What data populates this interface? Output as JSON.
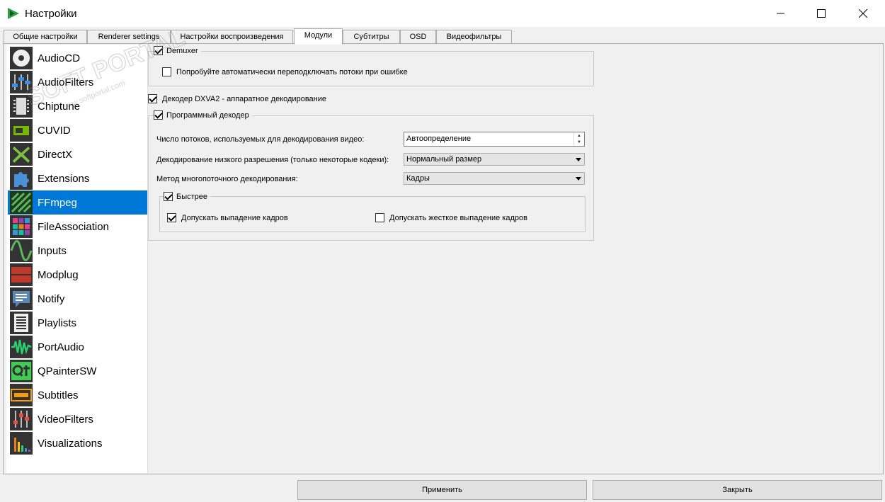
{
  "window": {
    "title": "Настройки",
    "accent": "#0078d7"
  },
  "tabs": [
    {
      "label": "Общие настройки",
      "active": false
    },
    {
      "label": "Renderer settings",
      "active": false
    },
    {
      "label": "Настройки воспроизведения",
      "active": false
    },
    {
      "label": "Модули",
      "active": true
    },
    {
      "label": "Субтитры",
      "active": false
    },
    {
      "label": "OSD",
      "active": false
    },
    {
      "label": "Видеофильтры",
      "active": false
    }
  ],
  "sidebar": {
    "selected": "FFmpeg",
    "items": [
      {
        "label": "AudioCD",
        "icon": "audiocd-icon"
      },
      {
        "label": "AudioFilters",
        "icon": "audiofilters-icon"
      },
      {
        "label": "Chiptune",
        "icon": "chiptune-icon"
      },
      {
        "label": "CUVID",
        "icon": "cuvid-icon"
      },
      {
        "label": "DirectX",
        "icon": "directx-icon"
      },
      {
        "label": "Extensions",
        "icon": "extensions-icon"
      },
      {
        "label": "FFmpeg",
        "icon": "ffmpeg-icon"
      },
      {
        "label": "FileAssociation",
        "icon": "fileassociation-icon"
      },
      {
        "label": "Inputs",
        "icon": "inputs-icon"
      },
      {
        "label": "Modplug",
        "icon": "modplug-icon"
      },
      {
        "label": "Notify",
        "icon": "notify-icon"
      },
      {
        "label": "Playlists",
        "icon": "playlists-icon"
      },
      {
        "label": "PortAudio",
        "icon": "portaudio-icon"
      },
      {
        "label": "QPainterSW",
        "icon": "qpaintersw-icon"
      },
      {
        "label": "Subtitles",
        "icon": "subtitles-icon"
      },
      {
        "label": "VideoFilters",
        "icon": "videofilters-icon"
      },
      {
        "label": "Visualizations",
        "icon": "visualizations-icon"
      }
    ]
  },
  "demuxer": {
    "title": "Demuxer",
    "checked": true,
    "auto_switch_label": "Попробуйте автоматически переподключать потоки при ошибке",
    "auto_switch_checked": false
  },
  "dxva2": {
    "label": "Декодер DXVA2 - аппаратное декодирование",
    "checked": true
  },
  "software_decoder": {
    "title": "Программный декодер",
    "checked": true,
    "threads_label": "Число потоков, используемых для декодирования видео:",
    "threads_value": "Автоопределение",
    "lowres_label": "Декодирование низкого разрешения (только некоторые кодеки):",
    "lowres_value": "Нормальный размер",
    "method_label": "Метод многопоточного декодирования:",
    "method_value": "Кадры",
    "faster": {
      "title": "Быстрее",
      "checked": true,
      "allow_drop_label": "Допускать выпадение кадров",
      "allow_drop_checked": true,
      "allow_hard_drop_label": "Допускать жесткое выпадение кадров",
      "allow_hard_drop_checked": false
    }
  },
  "buttons": {
    "apply": "Применить",
    "close": "Закрыть"
  },
  "watermark": {
    "text": "SOFT PORTAL",
    "url": "www.softportal.com"
  }
}
